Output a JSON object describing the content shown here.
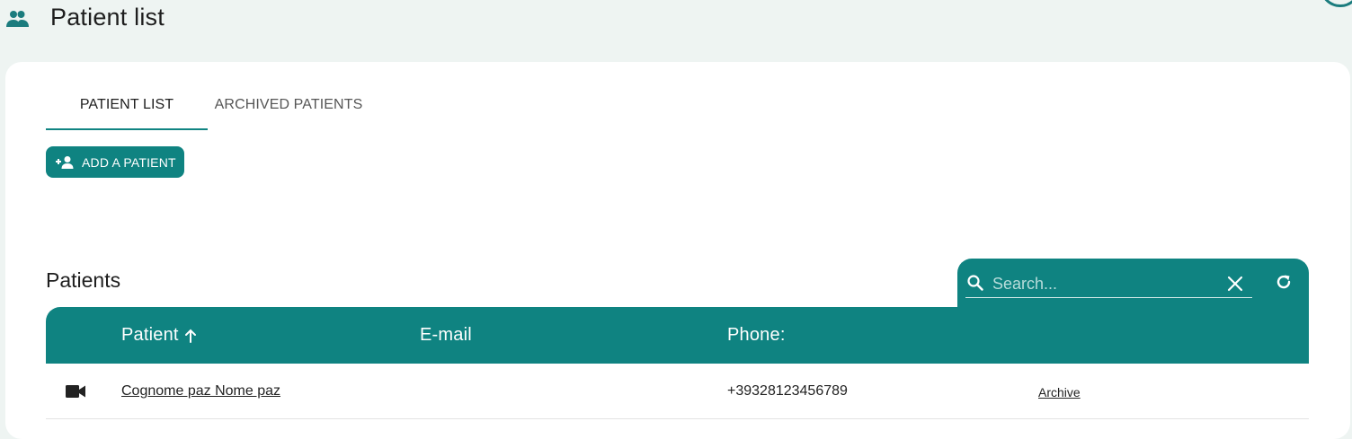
{
  "header": {
    "title": "Patient list",
    "icon": "people-icon"
  },
  "tabs": [
    {
      "label": "PATIENT LIST",
      "active": true
    },
    {
      "label": "ARCHIVED PATIENTS",
      "active": false
    }
  ],
  "add_button": {
    "label": "ADD A PATIENT",
    "icon": "person-add-icon"
  },
  "section": {
    "title": "Patients"
  },
  "search": {
    "placeholder": "Search...",
    "value": ""
  },
  "table": {
    "columns": [
      "Patient",
      "E-mail",
      "Phone:"
    ],
    "sort": {
      "column": "Patient",
      "direction": "ascending"
    },
    "rows": [
      {
        "name": "Cognome paz Nome paz",
        "email": "",
        "phone": "+39328123456789",
        "action": "Archive"
      }
    ]
  },
  "colors": {
    "accent": "#0f8381",
    "background": "#eef4f2",
    "card": "#ffffff"
  }
}
